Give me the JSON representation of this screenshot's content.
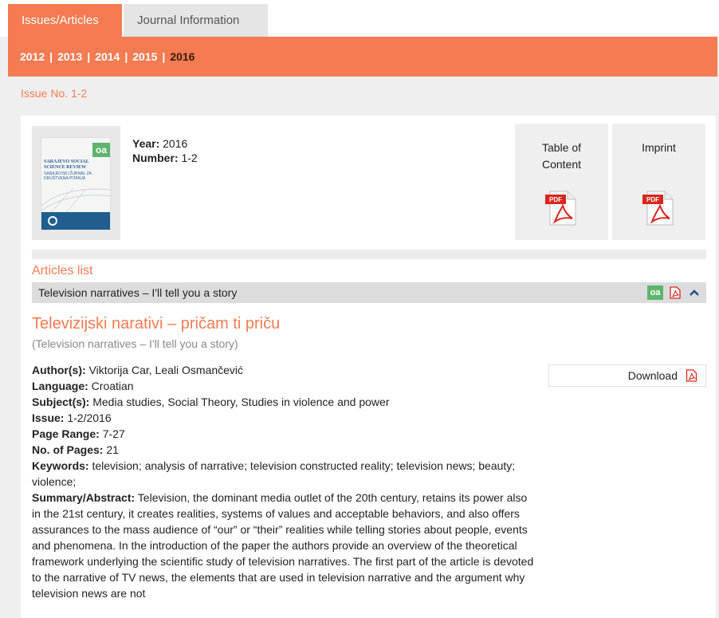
{
  "tabs": [
    {
      "label": "Issues/Articles",
      "active": true
    },
    {
      "label": "Journal Information",
      "active": false
    }
  ],
  "years": [
    "2012",
    "2013",
    "2014",
    "2015",
    "2016"
  ],
  "current_year": "2016",
  "issue_label": "Issue No. 1-2",
  "cover": {
    "oa": "oa",
    "title": "SARAJEVO SOCIAL SCIENCE REVIEW",
    "subtitle": "SARAJEVSKI ŽURNAL ZA DRUŠTVENA PITANJA"
  },
  "issue_meta": {
    "year_label": "Year:",
    "year": "2016",
    "number_label": "Number:",
    "number": "1-2"
  },
  "downloads": {
    "toc_label": "Table of Content",
    "imprint_label": "Imprint",
    "pdf_text": "PDF"
  },
  "articles_title": "Articles list",
  "article": {
    "row_title": "Television narratives – I'll tell you a story",
    "oa": "oa",
    "title": "Televizijski narativi – pričam ti priču",
    "original_title": "(Television narratives – I'll tell you a story)",
    "download_label": "Download",
    "fields": [
      {
        "label": "Author(s):",
        "value": "Viktorija Car, Leali Osmančević"
      },
      {
        "label": "Language:",
        "value": "Croatian"
      },
      {
        "label": "Subject(s):",
        "value": "Media studies, Social Theory, Studies in violence and power"
      },
      {
        "label": "Issue:",
        "value": "1-2/2016"
      },
      {
        "label": "Page Range:",
        "value": "7-27"
      },
      {
        "label": "No. of Pages:",
        "value": "21"
      },
      {
        "label": "Keywords:",
        "value": "television; analysis of narrative; television constructed reality; television news; beauty; violence;"
      },
      {
        "label": "Summary/Abstract:",
        "value": "Television, the dominant media outlet of the 20th century, retains its power also in the 21st century, it creates realities, systems of values and acceptable behaviors, and also offers assurances to the mass audience of “our” or “their” realities while telling stories about people, events and phenomena. In the introduction of the paper the authors provide an overview of the theoretical framework underlying the scientific study of television narratives. The first part of the article is devoted to the narrative of TV news, the elements that are used in television narrative and the argument why television news are not"
      }
    ]
  },
  "colors": {
    "accent": "#f47b52",
    "oa_green": "#5db56b",
    "pdf_red": "#d9261c"
  }
}
